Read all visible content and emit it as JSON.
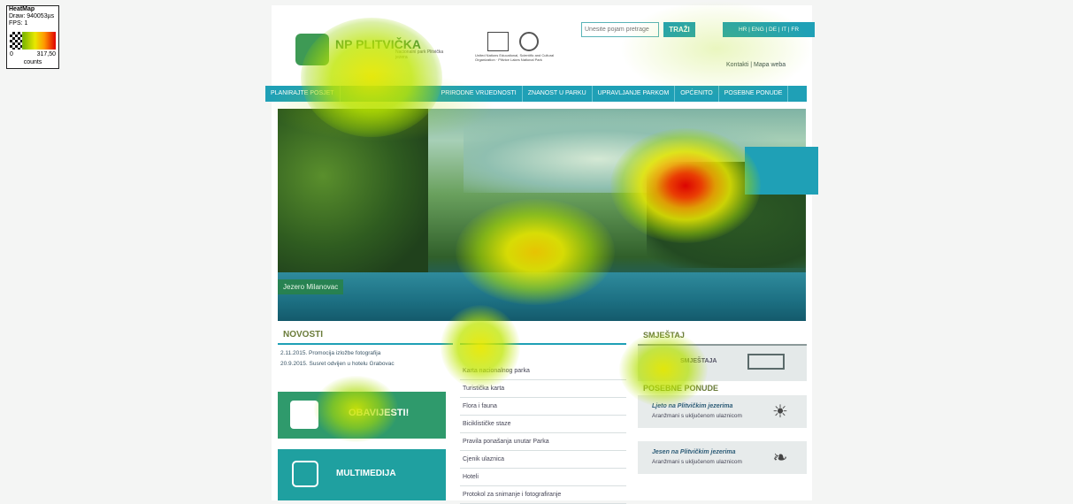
{
  "heatmap_legend": {
    "title": "HeatMap",
    "draw": "Draw: 940053µs",
    "fps": "FPS: 1",
    "min": "0",
    "max": "317,50",
    "unit": "counts"
  },
  "header": {
    "logo_text": "NP PLITVIČKA",
    "logo_sub": "Nacionalni park Plitvička jezera",
    "unesco_text": "United Nations Educational, Scientific and Cultural Organization · Plitvice Lakes National Park"
  },
  "search": {
    "placeholder": "Unesite pojam pretrage",
    "button": "TRAŽI"
  },
  "languages": "HR | ENG | DE | IT | FR",
  "top_links": "Kontakti | Mapa weba",
  "nav": [
    "PLANIRAJTE POSJET",
    "PRIRODNE VRIJEDNOSTI",
    "ZNANOST U PARKU",
    "UPRAVLJANJE PARKOM",
    "OPĆENITO",
    "POSEBNE PONUDE"
  ],
  "hero": {
    "caption": "Jezero Milanovac"
  },
  "news": {
    "heading": "NOVOSTI",
    "items": [
      "2.11.2015. Promocija izložbe fotografija",
      "20.9.2015. Susret odvijen u hotelu Grabovac"
    ]
  },
  "promo": {
    "obavijesti": "OBAVIJESTI!",
    "multimedija": "MULTIMEDIJA"
  },
  "links": [
    "Karta nacionalnog parka",
    "Turistička karta",
    "Flora i fauna",
    "Biciklističke staze",
    "Pravila ponašanja unutar Parka",
    "Cjenik ulaznica",
    "Hoteli",
    "Protokol za snimanje i fotografiranje"
  ],
  "accommodation": {
    "heading": "SMJEŠTAJ",
    "label": "SMJEŠTAJA"
  },
  "offers": {
    "heading": "POSEBNE PONUDE",
    "items": [
      {
        "title": "Ljeto na Plitvičkim jezerima",
        "subtitle": "Aranžmani s uključenom ulaznicom",
        "icon": "sun-icon"
      },
      {
        "title": "Jesen na Plitvičkim jezerima",
        "subtitle": "Aranžmani s uključenom ulaznicom",
        "icon": "leaf-icon"
      }
    ]
  },
  "colors": {
    "accent": "#1fa0b6",
    "green": "#2f9a6c",
    "heat_hot": "#e00000",
    "heat_warm": "#e8e800",
    "heat_cool": "#9acd00"
  }
}
